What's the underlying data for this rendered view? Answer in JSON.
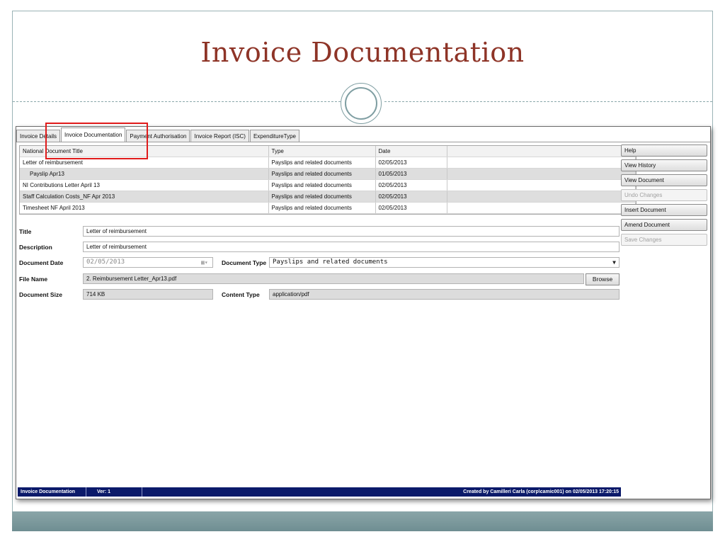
{
  "slide": {
    "title": "Invoice Documentation"
  },
  "tabs": [
    "Invoice Details",
    "Invoice Documentation",
    "Payment Authorisation",
    "Invoice Report (ISC)",
    "ExpenditureType"
  ],
  "active_tab": "Invoice Documentation",
  "grid": {
    "columns": [
      "National Document Title",
      "Type",
      "Date",
      ""
    ],
    "rows": [
      [
        "Letter of reimbursement",
        "Payslips and related documents",
        "02/05/2013"
      ],
      [
        "Payslip Apr13",
        "Payslips and related documents",
        "01/05/2013"
      ],
      [
        "NI Contributions Letter April 13",
        "Payslips and related documents",
        "02/05/2013"
      ],
      [
        "Staff Calculation Costs_NF Apr 2013",
        "Payslips and related documents",
        "02/05/2013"
      ],
      [
        "Timesheet NF April 2013",
        "Payslips and related documents",
        "02/05/2013"
      ]
    ]
  },
  "form": {
    "title_label": "Title",
    "title_value": "Letter of reimbursement",
    "description_label": "Description",
    "description_value": "Letter of reimbursement",
    "document_date_label": "Document Date",
    "document_date_value": "02/05/2013",
    "document_type_label": "Document Type",
    "document_type_value": "Payslips and related documents",
    "file_name_label": "File Name",
    "file_name_value": "2. Reimbursement Letter_Apr13.pdf",
    "browse_label": "Browse",
    "document_size_label": "Document Size",
    "document_size_value": "714 KB",
    "content_type_label": "Content Type",
    "content_type_value": "application/pdf"
  },
  "side_buttons": {
    "help": "Help",
    "view_history": "View History",
    "view_document": "View Document",
    "undo_changes": "Undo Changes",
    "insert_document": "Insert Document",
    "amend_document": "Amend Document",
    "save_changes": "Save Changes"
  },
  "statusbar": {
    "screen": "Invoice Documentation",
    "version": "Ver: 1",
    "created": "Created  by Camilleri Carla (corp\\camic001) on 02/05/2013 17:20:15"
  },
  "colors": {
    "title": "#8e3427",
    "statusbar": "#0b1a6a",
    "highlight": "#e01b1b",
    "band": "#7a989c"
  }
}
